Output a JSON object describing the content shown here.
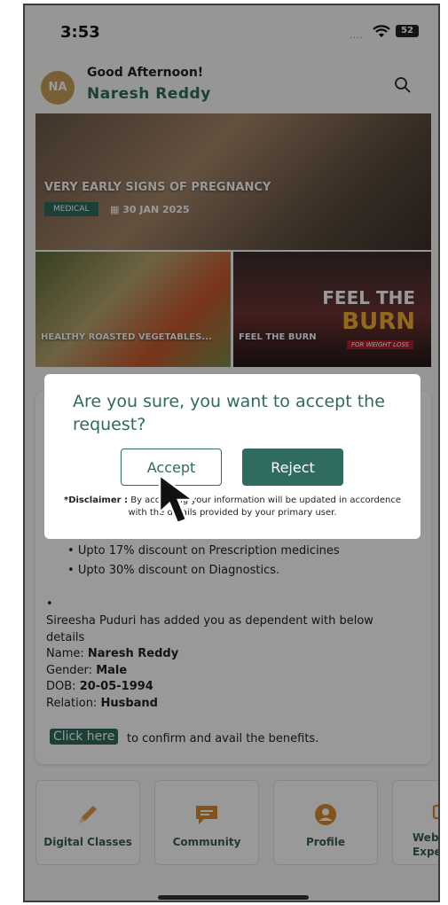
{
  "status_bar": {
    "time": "3:53",
    "signal": "....",
    "battery": "52"
  },
  "header": {
    "avatar_initials": "NA",
    "greeting": "Good Afternoon!",
    "user_name": "Naresh Reddy"
  },
  "banner": {
    "title": "VERY EARLY SIGNS OF PREGNANCY",
    "tag": "MEDICAL",
    "date": "30 JAN 2025"
  },
  "tiles": [
    {
      "caption": "HEALTHY ROASTED VEGETABLES..."
    },
    {
      "caption": "FEEL THE BURN",
      "overlay_line1": "FEEL THE",
      "overlay_line2": "BURN",
      "overlay_small": "FOR WEIGHT LOSS"
    }
  ],
  "dialog": {
    "question": "Are you sure, you want to accept the request?",
    "accept_label": "Accept",
    "reject_label": "Reject",
    "disclaimer_label": "*Disclaimer :",
    "disclaimer_text": "By accepting your information will be updated in accordence with the details provided by your primary user."
  },
  "benefits": [
    "Upto 17% discount on Prescription medicines",
    "Upto 30% discount on Diagnostics."
  ],
  "bullet_char": "•",
  "dependent": {
    "dot": "•",
    "intro_line1": "Sireesha Puduri has added you as dependent with below",
    "intro_line2": "details",
    "name_label": "Name:",
    "name_value": "Naresh Reddy",
    "gender_label": "Gender:",
    "gender_value": "Male",
    "dob_label": "DOB:",
    "dob_value": "20-05-1994",
    "relation_label": "Relation:",
    "relation_value": "Husband"
  },
  "cta": {
    "click_label": "Click here",
    "confirm_text": "to confirm and avail the benefits."
  },
  "bottom_nav": [
    {
      "label": "Digital Classes",
      "icon": "pencil-icon"
    },
    {
      "label": "Community",
      "icon": "chat-icon"
    },
    {
      "label": "Profile",
      "icon": "user-icon"
    },
    {
      "label": "Webi... Exper...",
      "icon": "webinar-icon"
    }
  ],
  "colors": {
    "brand": "#2f6b5e",
    "avatar": "#c89e5a",
    "nav_label": "#3b5f55"
  }
}
